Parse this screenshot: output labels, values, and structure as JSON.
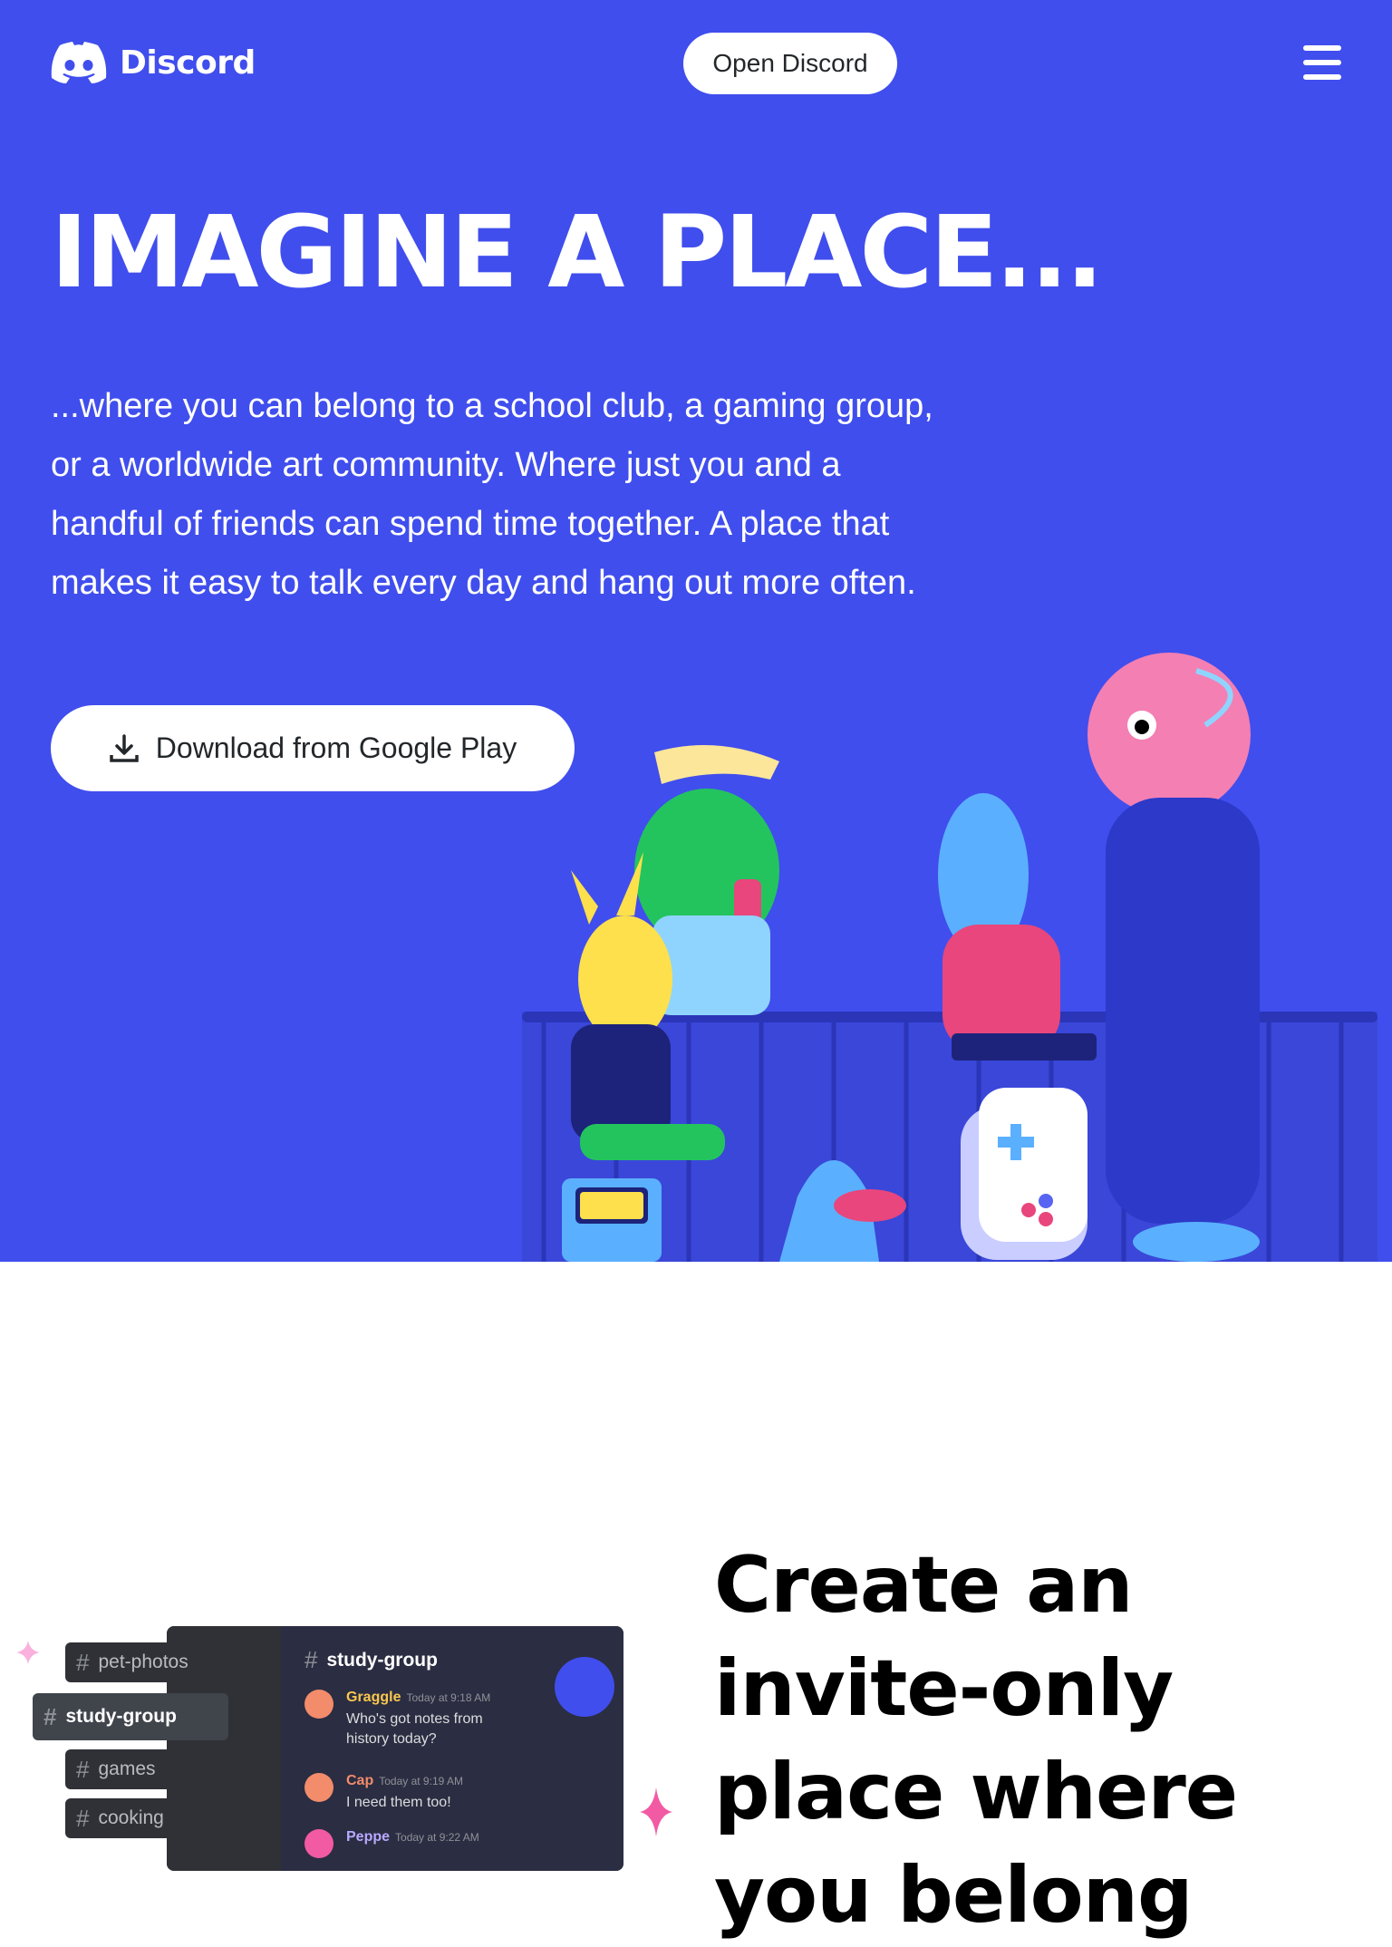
{
  "header": {
    "brand": "Discord",
    "open_button": "Open Discord",
    "menu_icon": "hamburger-menu-icon"
  },
  "hero": {
    "headline": "IMAGINE A PLACE...",
    "body": "...where you can belong to a school club, a gaming group, or a worldwide art community. Where just you and a handful of friends can spend time together. A place that makes it easy to talk every day and hang out more often.",
    "download_button": "Download from Google Play",
    "download_icon": "download-icon",
    "background_color": "#404eed"
  },
  "section2": {
    "heading": "Create an invite-only place where you belong",
    "channels": [
      {
        "name": "pet-photos",
        "active": false
      },
      {
        "name": "study-group",
        "active": true
      },
      {
        "name": "games",
        "active": false
      },
      {
        "name": "cooking",
        "active": false
      }
    ],
    "chat": {
      "channel_title": "study-group",
      "messages": [
        {
          "author": "Graggle",
          "time": "Today at 9:18 AM",
          "text": "Who's got notes from history today?",
          "color": "#f9c74f"
        },
        {
          "author": "Cap",
          "time": "Today at 9:19 AM",
          "text": "I need them too!",
          "color": "#f28c6b"
        },
        {
          "author": "Peppe",
          "time": "Today at 9:22 AM",
          "text": "",
          "color": "#b9a9ff"
        }
      ]
    }
  }
}
